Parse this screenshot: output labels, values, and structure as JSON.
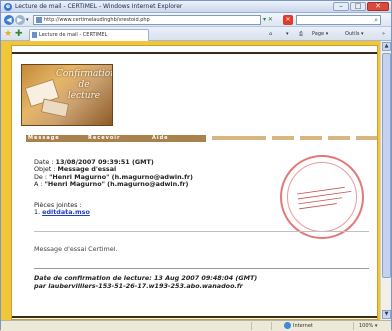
{
  "window": {
    "title": "Lecture de mail - CERTIMEL - Windows Internet Explorer",
    "minimize": "–",
    "maximize": "□",
    "close": "✕"
  },
  "address_bar": {
    "url": "http://www.certimelaudinghb/vrestoid.php",
    "go": "▾ ✕",
    "search_placeholder": ""
  },
  "tab": {
    "label": "Lecture de mail - CERTIMEL"
  },
  "command_bar": {
    "home": "⌂",
    "feeds": "▾",
    "print": "⎙",
    "page": "Page ▾",
    "tools": "Outils ▾",
    "more": "»"
  },
  "logo": {
    "text_line1": "Confirmation",
    "text_line2": "de",
    "text_line3": "lecture"
  },
  "menu": {
    "items": [
      "Message",
      "Recevoir",
      "Aide"
    ]
  },
  "message": {
    "date_label": "Date : ",
    "date_value": "13/08/2007 09:39:51 (GMT)",
    "subject_label": "Objet : ",
    "subject_value": "Message d'essai",
    "from_label": "De : ",
    "from_value": "\"Henri Magurno\" (h.magurno@adwin.fr)",
    "to_label": "A : ",
    "to_value": "\"Henri Magurno\" (h.magurno@adwin.fr)",
    "attachments_label": "Pièces jointes :",
    "attachment_index": "1. ",
    "attachment_name": "editdata.mso",
    "body": "Message d'essai Certimel.",
    "read_confirmation_line1": "Date de confirmation de lecture: 13 Aug 2007 09:48:04 (GMT)",
    "read_confirmation_line2": "par laubervilliers-153-51-26-17.w193-253.abo.wanadoo.fr"
  },
  "status_bar": {
    "zone": "Internet",
    "zoom": "100% ▾"
  }
}
